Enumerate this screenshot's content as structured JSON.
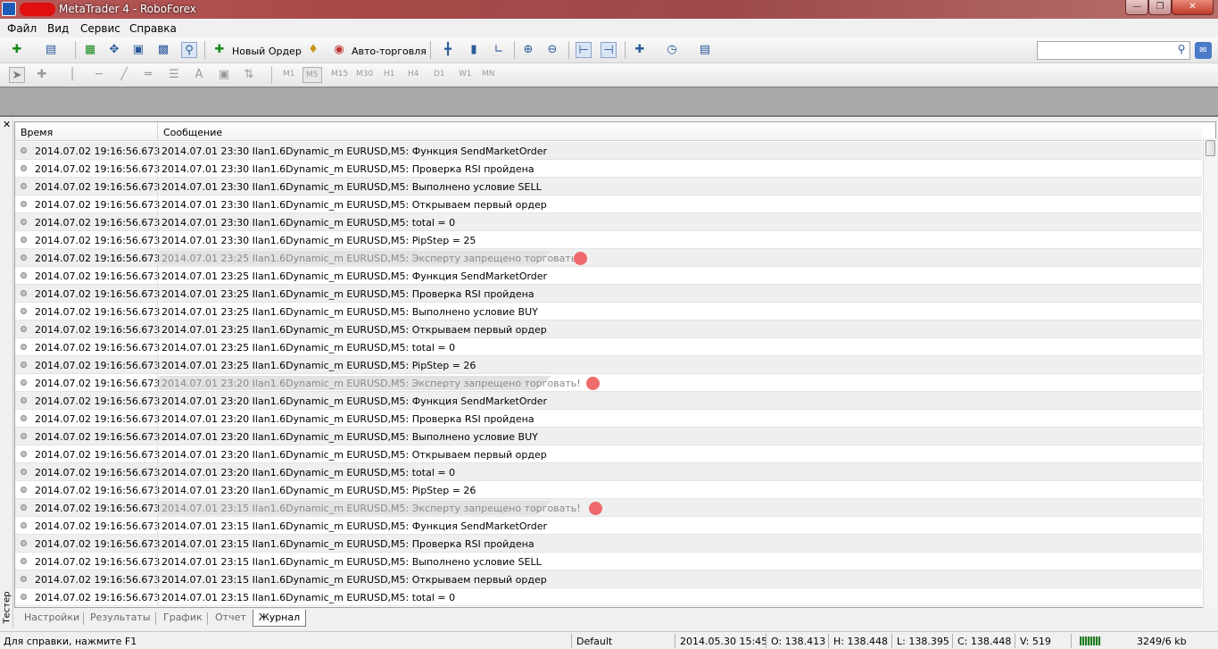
{
  "window": {
    "title": "MetaTrader 4 - RoboForex"
  },
  "menu": [
    "Файл",
    "Вид",
    "Сервис",
    "Справка"
  ],
  "toolbar": {
    "new_order": "Новый Ордер",
    "auto_trading": "Авто-торговля"
  },
  "timeframes": [
    "M1",
    "M5",
    "M15",
    "M30",
    "H1",
    "H4",
    "D1",
    "W1",
    "MN"
  ],
  "journal": {
    "col_time": "Время",
    "col_message": "Сообщение",
    "rows": [
      {
        "time": "2014.07.02 19:16:56.673",
        "message": "2014.07.01 23:30  Ilan1.6Dynamic_m EURUSD,M5: Функция SendMarketOrder",
        "warn": false
      },
      {
        "time": "2014.07.02 19:16:56.673",
        "message": "2014.07.01 23:30  Ilan1.6Dynamic_m EURUSD,M5: Проверка RSI пройдена",
        "warn": false
      },
      {
        "time": "2014.07.02 19:16:56.673",
        "message": "2014.07.01 23:30  Ilan1.6Dynamic_m EURUSD,M5: Выполнено условие SELL",
        "warn": false
      },
      {
        "time": "2014.07.02 19:16:56.673",
        "message": "2014.07.01 23:30  Ilan1.6Dynamic_m EURUSD,M5: Открываем первый ордер",
        "warn": false
      },
      {
        "time": "2014.07.02 19:16:56.673",
        "message": "2014.07.01 23:30  Ilan1.6Dynamic_m EURUSD,M5: total = 0",
        "warn": false
      },
      {
        "time": "2014.07.02 19:16:56.673",
        "message": "2014.07.01 23:30  Ilan1.6Dynamic_m EURUSD,M5: PipStep = 25",
        "warn": false
      },
      {
        "time": "2014.07.02 19:16:56.673",
        "message": "2014.07.01 23:25  Ilan1.6Dynamic_m EURUSD,M5: Эксперту запрещено торговать!",
        "warn": true
      },
      {
        "time": "2014.07.02 19:16:56.673",
        "message": "2014.07.01 23:25  Ilan1.6Dynamic_m EURUSD,M5: Функция SendMarketOrder",
        "warn": false
      },
      {
        "time": "2014.07.02 19:16:56.673",
        "message": "2014.07.01 23:25  Ilan1.6Dynamic_m EURUSD,M5: Проверка RSI пройдена",
        "warn": false
      },
      {
        "time": "2014.07.02 19:16:56.673",
        "message": "2014.07.01 23:25  Ilan1.6Dynamic_m EURUSD,M5: Выполнено условие BUY",
        "warn": false
      },
      {
        "time": "2014.07.02 19:16:56.673",
        "message": "2014.07.01 23:25  Ilan1.6Dynamic_m EURUSD,M5: Открываем первый ордер",
        "warn": false
      },
      {
        "time": "2014.07.02 19:16:56.673",
        "message": "2014.07.01 23:25  Ilan1.6Dynamic_m EURUSD,M5: total = 0",
        "warn": false
      },
      {
        "time": "2014.07.02 19:16:56.673",
        "message": "2014.07.01 23:25  Ilan1.6Dynamic_m EURUSD,M5: PipStep = 26",
        "warn": false
      },
      {
        "time": "2014.07.02 19:16:56.673",
        "message": "2014.07.01 23:20  Ilan1.6Dynamic_m EURUSD,M5: Эксперту запрещено торговать!",
        "warn": true
      },
      {
        "time": "2014.07.02 19:16:56.673",
        "message": "2014.07.01 23:20  Ilan1.6Dynamic_m EURUSD,M5: Функция SendMarketOrder",
        "warn": false
      },
      {
        "time": "2014.07.02 19:16:56.673",
        "message": "2014.07.01 23:20  Ilan1.6Dynamic_m EURUSD,M5: Проверка RSI пройдена",
        "warn": false
      },
      {
        "time": "2014.07.02 19:16:56.673",
        "message": "2014.07.01 23:20  Ilan1.6Dynamic_m EURUSD,M5: Выполнено условие BUY",
        "warn": false
      },
      {
        "time": "2014.07.02 19:16:56.673",
        "message": "2014.07.01 23:20  Ilan1.6Dynamic_m EURUSD,M5: Открываем первый ордер",
        "warn": false
      },
      {
        "time": "2014.07.02 19:16:56.673",
        "message": "2014.07.01 23:20  Ilan1.6Dynamic_m EURUSD,M5: total = 0",
        "warn": false
      },
      {
        "time": "2014.07.02 19:16:56.673",
        "message": "2014.07.01 23:20  Ilan1.6Dynamic_m EURUSD,M5: PipStep = 26",
        "warn": false
      },
      {
        "time": "2014.07.02 19:16:56.673",
        "message": "2014.07.01 23:15  Ilan1.6Dynamic_m EURUSD,M5: Эксперту запрещено торговать!",
        "warn": true
      },
      {
        "time": "2014.07.02 19:16:56.673",
        "message": "2014.07.01 23:15  Ilan1.6Dynamic_m EURUSD,M5: Функция SendMarketOrder",
        "warn": false
      },
      {
        "time": "2014.07.02 19:16:56.673",
        "message": "2014.07.01 23:15  Ilan1.6Dynamic_m EURUSD,M5: Проверка RSI пройдена",
        "warn": false
      },
      {
        "time": "2014.07.02 19:16:56.673",
        "message": "2014.07.01 23:15  Ilan1.6Dynamic_m EURUSD,M5: Выполнено условие SELL",
        "warn": false
      },
      {
        "time": "2014.07.02 19:16:56.673",
        "message": "2014.07.01 23:15  Ilan1.6Dynamic_m EURUSD,M5: Открываем первый ордер",
        "warn": false
      },
      {
        "time": "2014.07.02 19:16:56.673",
        "message": "2014.07.01 23:15  Ilan1.6Dynamic_m EURUSD,M5: total = 0",
        "warn": false
      }
    ]
  },
  "tester": {
    "label": "Тестер",
    "tabs": [
      "Настройки",
      "Результаты",
      "График",
      "Отчет",
      "Журнал"
    ],
    "active_tab": "Журнал"
  },
  "status": {
    "help": "Для справки, нажмите F1",
    "profile": "Default",
    "datetime": "2014.05.30 15:45",
    "open": "O: 138.413",
    "high": "H: 138.448",
    "low": "L: 138.395",
    "close": "C: 138.448",
    "volume": "V: 519",
    "traffic": "3249/6 kb"
  },
  "colors": {
    "warn_marker": "#ef6a6a",
    "title_bar": "#a64848"
  }
}
